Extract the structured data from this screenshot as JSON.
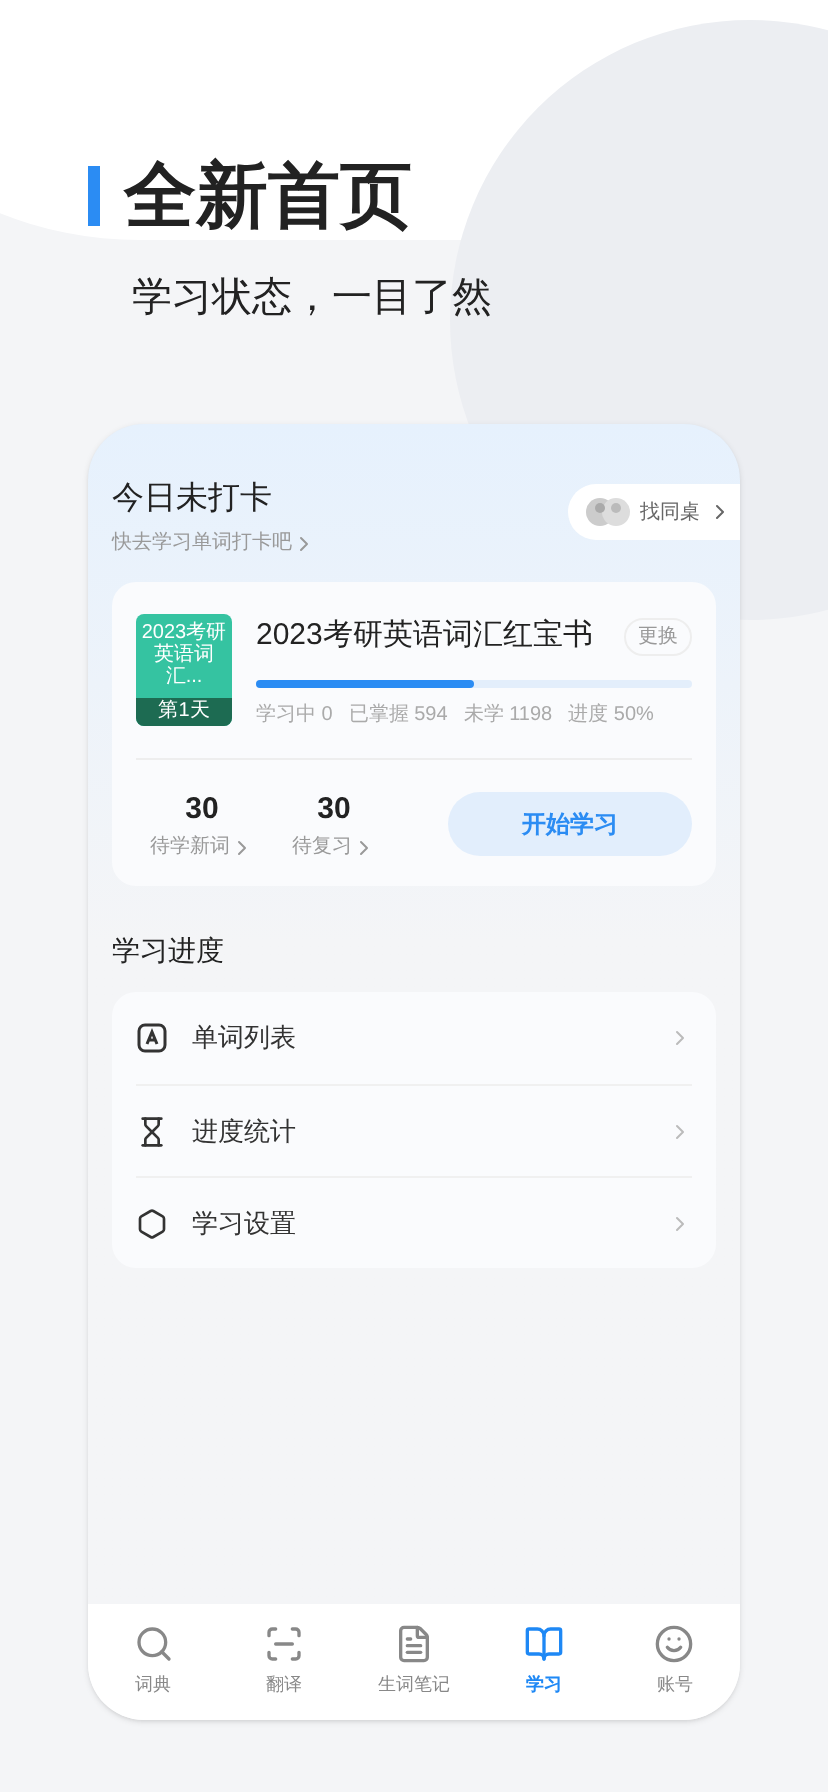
{
  "promo": {
    "title": "全新首页",
    "subtitle": "学习状态，一目了然"
  },
  "checkin": {
    "title": "今日未打卡",
    "hint": "快去学习单词打卡吧",
    "deskmate": "找同桌"
  },
  "book": {
    "cover_title": "2023考研英语词汇...",
    "cover_day": "第1天",
    "title": "2023考研英语词汇红宝书",
    "change": "更换",
    "level": 0.5,
    "stats": [
      {
        "label": "学习中",
        "value": "0"
      },
      {
        "label": "已掌握",
        "value": "594"
      },
      {
        "label": "未学",
        "value": "1198"
      },
      {
        "label": "进度",
        "value": "50%"
      }
    ]
  },
  "counts": [
    {
      "value": "30",
      "label": "待学新词"
    },
    {
      "value": "30",
      "label": "待复习"
    }
  ],
  "start": "开始学习",
  "section": "学习进度",
  "menu": [
    {
      "kind": "list",
      "label": "单词列表"
    },
    {
      "kind": "stats",
      "label": "进度统计"
    },
    {
      "kind": "settings",
      "label": "学习设置"
    }
  ],
  "tabs": [
    {
      "kind": "dictionary",
      "label": "词典",
      "selected": false
    },
    {
      "kind": "translate",
      "label": "翻译",
      "selected": false
    },
    {
      "kind": "notes",
      "label": "生词笔记",
      "selected": false
    },
    {
      "kind": "study",
      "label": "学习",
      "selected": true
    },
    {
      "kind": "account",
      "label": "账号",
      "selected": false
    }
  ]
}
